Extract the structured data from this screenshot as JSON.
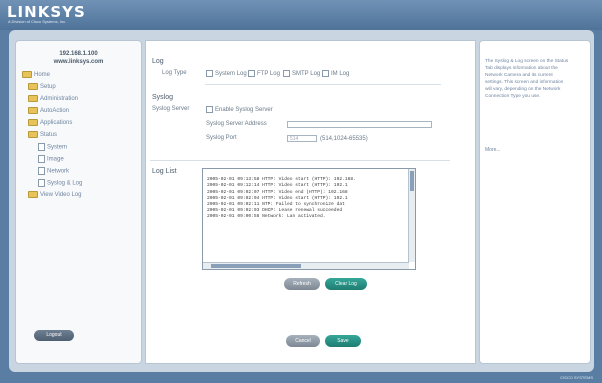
{
  "header": {
    "logo": "LINKSYS",
    "tagline": "A Division of Cisco Systems, Inc."
  },
  "sidebar": {
    "ip": "192.168.1.100",
    "host": "www.linksys.com",
    "items": [
      {
        "label": "Home"
      },
      {
        "label": "Setup"
      },
      {
        "label": "Administration"
      },
      {
        "label": "AutoAction"
      },
      {
        "label": "Applications"
      },
      {
        "label": "Status"
      },
      {
        "label": "System"
      },
      {
        "label": "Image"
      },
      {
        "label": "Network"
      },
      {
        "label": "Syslog & Log"
      },
      {
        "label": "View Video Log"
      }
    ],
    "logout_label": "Logout"
  },
  "main": {
    "log": {
      "heading": "Log",
      "type_label": "Log Type",
      "options": [
        "System Log",
        "FTP Log",
        "SMTP Log",
        "IM Log"
      ]
    },
    "syslog": {
      "heading": "Syslog",
      "server_label": "Syslog Server",
      "enable_label": "Enable Syslog Server",
      "address_label": "Syslog Server Address",
      "port_label": "Syslog Port",
      "port_value": "514",
      "port_hint": "(514,1024-65535)"
    },
    "loglist": {
      "heading": "Log List",
      "lines": [
        "2005-02-01 09:13:58 HTTP: Video start (HTTP): 192.168.",
        "2005-02-01 09:12:14 HTTP: Video start (HTTP): 192.1",
        "2005-02-01 09:02:07 HTTP: Video end (HTTP): 192.168",
        "2005-02-01 09:02:04 HTTP: Video start (HTTP): 192.1",
        "2005-02-01 09:02:11 NTP: Failed to synchronize dat",
        "2005-02-01 09:02:03 DHCP: Lease renewal succeeded",
        "2005-02-01 09:00:58 Network: Lan activated."
      ],
      "refresh_label": "Refresh",
      "clear_label": "Clear Log"
    },
    "cancel_label": "Cancel",
    "save_label": "Save"
  },
  "help": {
    "text": "The Syslog & Log screen on the Status Tab displays information about the Network Camera and its current settings. This screen and information will vary, depending on the Network Connection Type you use.",
    "more_label": "More..."
  },
  "footer": {
    "brand": "CISCO SYSTEMS"
  },
  "colors": {
    "accent": "#2a9a8c",
    "frame": "#5a7ea3"
  }
}
